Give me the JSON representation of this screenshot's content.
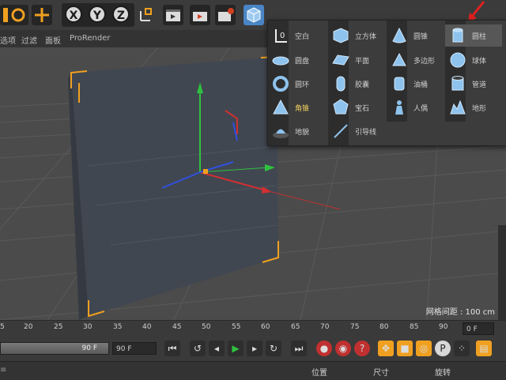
{
  "toolbar": {
    "axis_x": "X",
    "axis_y": "Y",
    "axis_z": "Z"
  },
  "menubar": {
    "items": [
      "选项",
      "过滤",
      "面板",
      "ProRender"
    ]
  },
  "viewport": {
    "grid_spacing_label": "网格间距 : 100 cm"
  },
  "primitives_menu": {
    "items": [
      {
        "label": "空白",
        "icon": "null-object-icon"
      },
      {
        "label": "圆盘",
        "icon": "disc-icon"
      },
      {
        "label": "圆环",
        "icon": "torus-icon"
      },
      {
        "label": "角锥",
        "icon": "pyramid-icon"
      },
      {
        "label": "地貌",
        "icon": "landscape-icon"
      },
      {
        "label": "立方体",
        "icon": "cube-icon"
      },
      {
        "label": "平面",
        "icon": "plane-icon"
      },
      {
        "label": "胶囊",
        "icon": "capsule-icon"
      },
      {
        "label": "宝石",
        "icon": "gem-icon"
      },
      {
        "label": "引导线",
        "icon": "guide-line-icon"
      },
      {
        "label": "圆锥",
        "icon": "cone-icon"
      },
      {
        "label": "多边形",
        "icon": "polygon-icon"
      },
      {
        "label": "油桶",
        "icon": "oil-tank-icon"
      },
      {
        "label": "人偶",
        "icon": "figure-icon"
      },
      {
        "label": "圆柱",
        "icon": "cylinder-icon"
      },
      {
        "label": "球体",
        "icon": "sphere-icon"
      },
      {
        "label": "管道",
        "icon": "tube-icon"
      },
      {
        "label": "地形",
        "icon": "terrain-icon"
      }
    ],
    "selected": "圆柱"
  },
  "timeline": {
    "ruler_ticks": [
      "5",
      "20",
      "25",
      "30",
      "35",
      "40",
      "45",
      "50",
      "55",
      "60",
      "65",
      "70",
      "75",
      "80",
      "85",
      "90"
    ],
    "current_frame": "0 F",
    "end_frame_slider": "90 F",
    "end_frame": "90 F"
  },
  "attributes_header": {
    "position": "位置",
    "size": "尺寸",
    "rotation": "旋转"
  },
  "colors": {
    "accent_blue": "#2f8fd9",
    "selection_orange": "#f0a020",
    "axis_red": "#d03030",
    "axis_green": "#30c040",
    "axis_blue": "#3050e0"
  }
}
